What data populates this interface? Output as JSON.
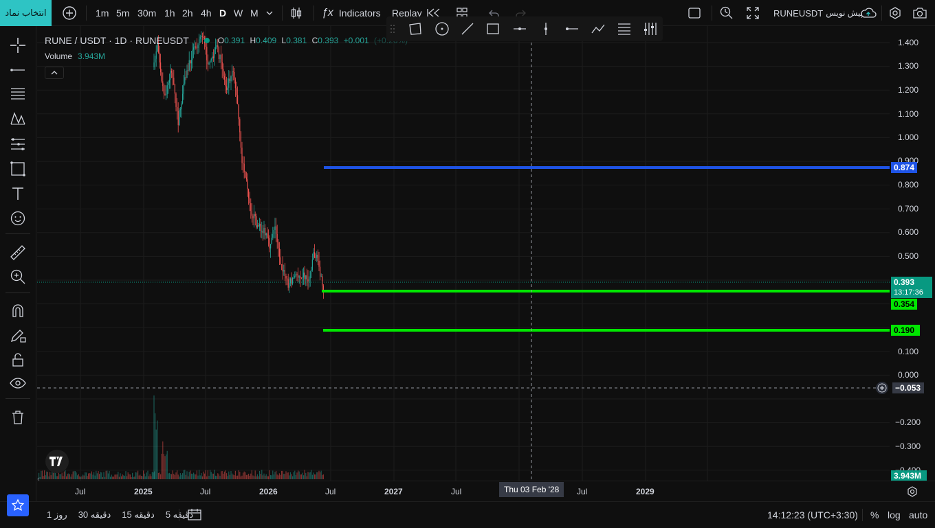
{
  "topbar": {
    "symbol_button": "انتخاب نماد",
    "intervals": [
      "1m",
      "5m",
      "30m",
      "1h",
      "2h",
      "4h",
      "D",
      "W",
      "M"
    ],
    "active_interval": "D",
    "indicators_label": "Indicators",
    "replay_label": "Replay",
    "symbol_name": "RUNEUSDT",
    "draft_label": "پیش نویس"
  },
  "legend": {
    "title": "RUNE / USDT · 1D · RUNEUSDT",
    "open_label": "O",
    "open": "0.391",
    "high_label": "H",
    "high": "0.409",
    "low_label": "L",
    "low": "0.381",
    "close_label": "C",
    "close": "0.393",
    "change": "+0.001",
    "change_pct": "(+0.26%)",
    "volume_label": "Volume",
    "volume_value": "3.943M"
  },
  "price_axis": {
    "ticks": [
      "1.400",
      "1.300",
      "1.200",
      "1.100",
      "1.000",
      "0.900",
      "0.800",
      "0.700",
      "0.600",
      "0.500",
      "0.400",
      "0.100",
      "0.000",
      "−0.200",
      "−0.300",
      "−0.400"
    ],
    "tags": {
      "blue_line": "0.874",
      "last_price": "0.393",
      "countdown": "13:17:36",
      "green_line_1": "0.354",
      "green_line_2": "0.190",
      "crosshair": "−0.053",
      "volume": "3.943M"
    }
  },
  "time_axis": {
    "labels": [
      "Jul",
      "2025",
      "Jul",
      "2026",
      "Jul",
      "2027",
      "Jul",
      "Jul",
      "2029"
    ],
    "crosshair_label": "Thu 03 Feb '28"
  },
  "bottombar": {
    "ranges": [
      "روز 1",
      "دقیقه 30",
      "دقیقه 15",
      "دقیقه 5"
    ],
    "clock": "14:12:23 (UTC+3:30)",
    "percent_label": "%",
    "log_label": "log",
    "auto_label": "auto"
  },
  "colors": {
    "accent": "#2ec4c4",
    "blue_line": "#1e53e5",
    "green_line": "#00e600",
    "last_price": "#089981",
    "up": "#26a69a",
    "down": "#ef5350"
  }
}
